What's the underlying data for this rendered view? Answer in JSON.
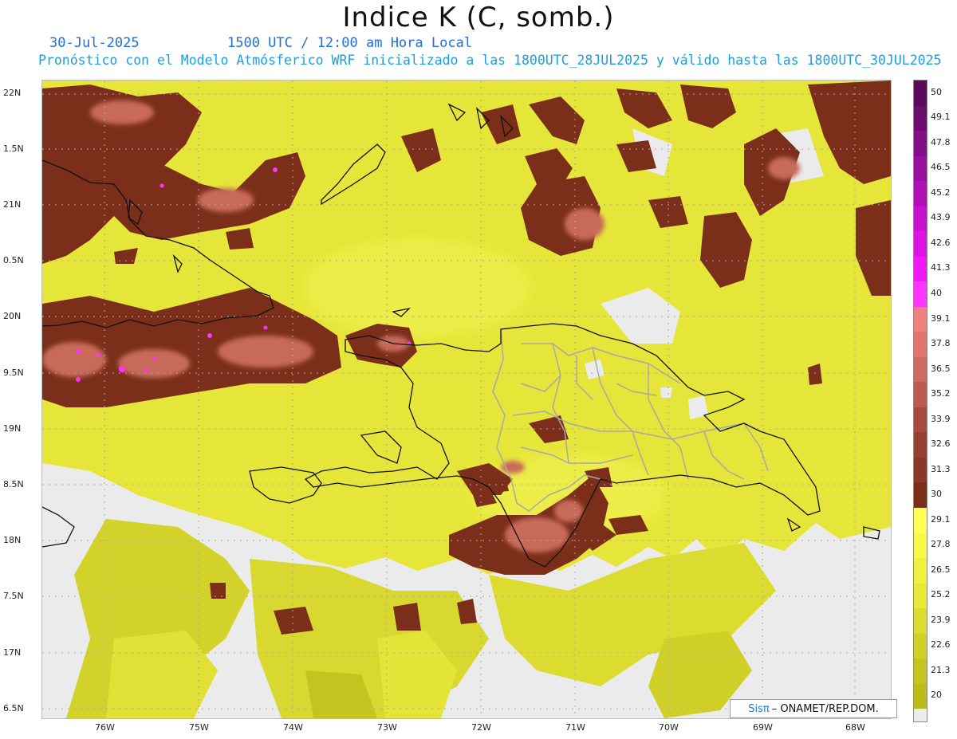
{
  "header": {
    "title": "Indice K (C, somb.)",
    "date": "30-Jul-2025",
    "time": "1500 UTC / 12:00 am Hora Local",
    "forecast": "Pronóstico con el Modelo Atmósferico WRF inicializado a las 1800UTC_28JUL2025 y válido hasta las  1800UTC_30JUL2025"
  },
  "axes": {
    "lat_labels": [
      "22N",
      "1.5N",
      "21N",
      "0.5N",
      "20N",
      "9.5N",
      "19N",
      "8.5N",
      "18N",
      "7.5N",
      "17N",
      "6.5N"
    ],
    "lon_labels": [
      "76W",
      "75W",
      "74W",
      "73W",
      "72W",
      "71W",
      "70W",
      "69W",
      "68W"
    ]
  },
  "colorbar": {
    "labels": [
      "50",
      "49.1",
      "47.8",
      "46.5",
      "45.2",
      "43.9",
      "42.6",
      "41.3",
      "40",
      "39.1",
      "37.8",
      "36.5",
      "35.2",
      "33.9",
      "32.6",
      "31.3",
      "30",
      "29.1",
      "27.8",
      "26.5",
      "25.2",
      "23.9",
      "22.6",
      "21.3",
      "20"
    ],
    "colors": [
      "#5a0a5a",
      "#6b0d6d",
      "#820f85",
      "#9a109e",
      "#b010b6",
      "#c812ce",
      "#dd14e2",
      "#f018f5",
      "#ff33ff",
      "#f08080",
      "#e07570",
      "#d06a60",
      "#c05a50",
      "#a84a3e",
      "#984030",
      "#883a26",
      "#7a3018",
      "#ffff55",
      "#f8f84a",
      "#f0f040",
      "#e8e838",
      "#dcdc30",
      "#d0d028",
      "#c4c420",
      "#bcbc18"
    ]
  },
  "legend": {
    "low_color": "#ebebeb"
  },
  "credit": {
    "brand": "Sisπ",
    "text": "– ONAMET/REP.DOM."
  },
  "colors": {
    "yellow_main": "#e6e63a",
    "yellow_dark": "#c8c828",
    "brown": "#7b2f1a",
    "salmon": "#c86a5a",
    "land_outline": "#111111",
    "province_outline": "#a8a8a8",
    "magenta": "#ff33ff"
  }
}
